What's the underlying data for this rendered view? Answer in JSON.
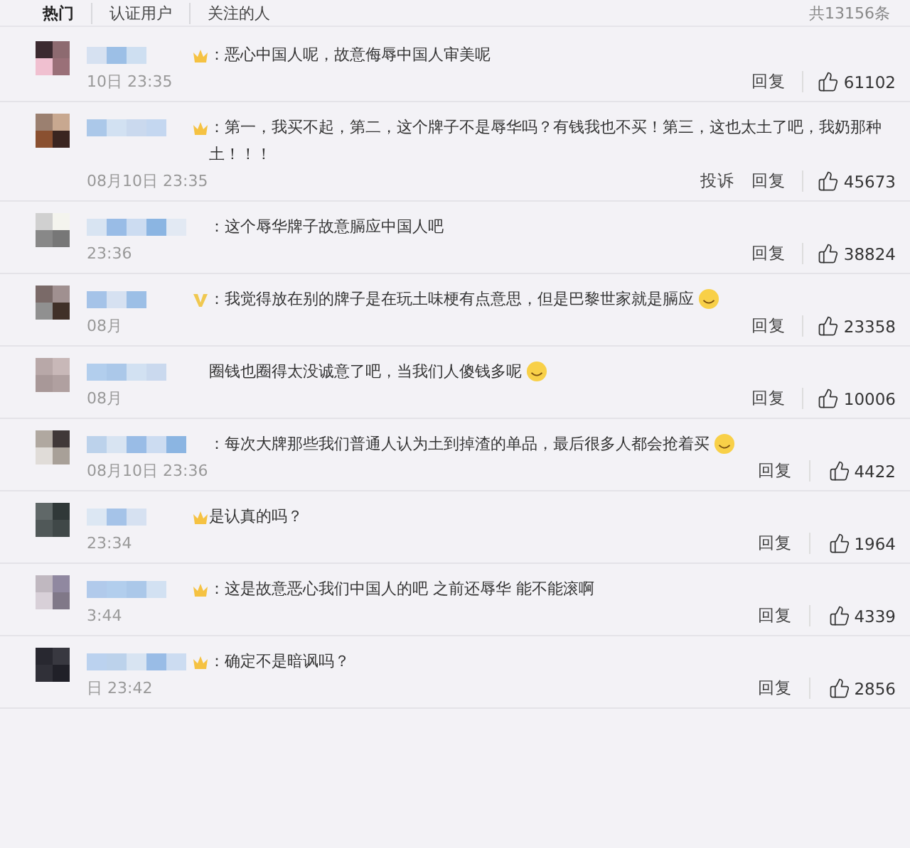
{
  "tabs": [
    {
      "label": "热门",
      "selected": true
    },
    {
      "label": "认证用户",
      "selected": false
    },
    {
      "label": "关注的人",
      "selected": false
    }
  ],
  "total": "共13156条",
  "comments": [
    {
      "kind": "crown",
      "text": "：恶心中国人呢，故意侮辱中国人审美呢",
      "emoji": false,
      "time": "10日 23:35",
      "actions": [
        "回复"
      ],
      "likes": "61102"
    },
    {
      "kind": "crown",
      "text": "：第一，我买不起，第二，这个牌子不是辱华吗？有钱我也不买！第三，这也太土了吧，我奶那种土！！！",
      "emoji": false,
      "time": "08月10日 23:35",
      "actions": [
        "投诉",
        "回复"
      ],
      "likes": "45673"
    },
    {
      "kind": "none",
      "text": "：这个辱华牌子故意膈应中国人吧",
      "emoji": false,
      "time": "23:36",
      "actions": [
        "回复"
      ],
      "likes": "38824"
    },
    {
      "kind": "v",
      "text": "：我觉得放在别的牌子是在玩土味梗有点意思，但是巴黎世家就是膈应",
      "emoji": true,
      "time": "08月",
      "actions": [
        "回复"
      ],
      "likes": "23358"
    },
    {
      "kind": "none",
      "text": "圈钱也圈得太没诚意了吧，当我们人傻钱多呢",
      "emoji": true,
      "time": "08月",
      "actions": [
        "回复"
      ],
      "likes": "10006"
    },
    {
      "kind": "none",
      "text": "：每次大牌那些我们普通人认为土到掉渣的单品，最后很多人都会抢着买",
      "emoji": true,
      "time": "08月10日 23:36",
      "actions": [
        "回复"
      ],
      "likes": "4422"
    },
    {
      "kind": "crown",
      "text": "是认真的吗？",
      "emoji": false,
      "time": "23:34",
      "actions": [
        "回复"
      ],
      "likes": "1964"
    },
    {
      "kind": "crown",
      "text": "：这是故意恶心我们中国人的吧 之前还辱华 能不能滚啊",
      "emoji": false,
      "time": "3:44",
      "actions": [
        "回复"
      ],
      "likes": "4339"
    },
    {
      "kind": "crown",
      "text": "：确定不是暗讽吗？",
      "emoji": false,
      "time": "日 23:42",
      "actions": [
        "回复"
      ],
      "likes": "2856"
    }
  ]
}
